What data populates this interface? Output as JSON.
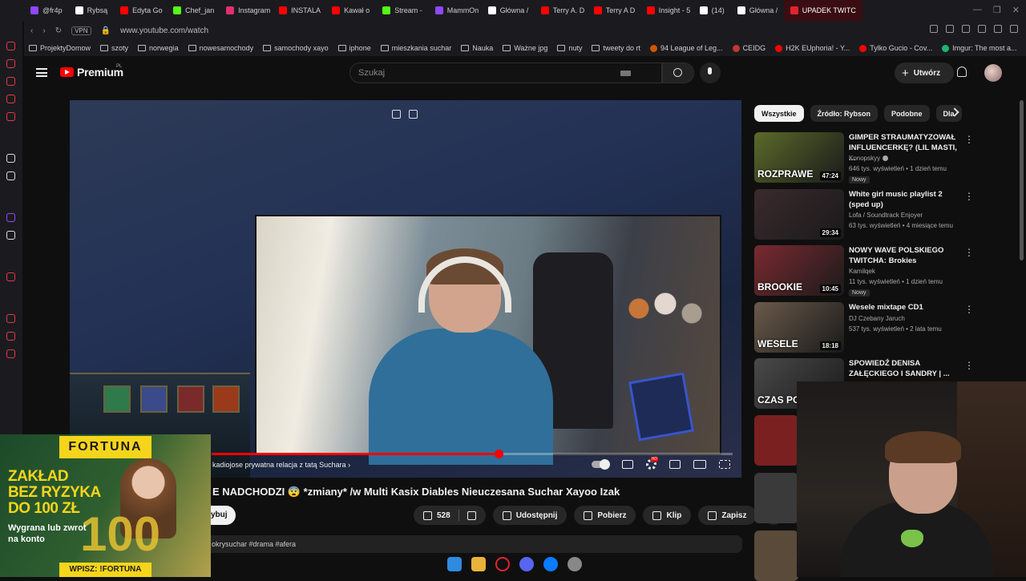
{
  "browser": {
    "tabs": [
      {
        "label": "@fr4p",
        "color": "#9146ff"
      },
      {
        "label": "Rybsą",
        "color": "#ffffff"
      },
      {
        "label": "Edyta Go",
        "color": "#ff0000"
      },
      {
        "label": "Chef_jan",
        "color": "#53fc18"
      },
      {
        "label": "Instagram",
        "color": "#e1306c"
      },
      {
        "label": "INSTALA",
        "color": "#ff0000"
      },
      {
        "label": "Kawał o",
        "color": "#ff0000"
      },
      {
        "label": "Stream -",
        "color": "#53fc18"
      },
      {
        "label": "MammOn",
        "color": "#9146ff"
      },
      {
        "label": "Główna /",
        "color": "#ffffff"
      },
      {
        "label": "Terry A. D",
        "color": "#ff0000"
      },
      {
        "label": "Terry A D",
        "color": "#ff0000"
      },
      {
        "label": "Insight - 5",
        "color": "#ff0000"
      },
      {
        "label": "(14)",
        "color": "#ffffff"
      },
      {
        "label": "Główna /",
        "color": "#ffffff"
      },
      {
        "label": "UPADEK TWITC",
        "color": "#e0242f"
      }
    ],
    "url": "www.youtube.com/watch",
    "vpn_label": "VPN",
    "bookmarks": [
      {
        "label": "ProjektyDomow",
        "kind": "folder"
      },
      {
        "label": "szoty",
        "kind": "folder"
      },
      {
        "label": "norwegia",
        "kind": "folder"
      },
      {
        "label": "nowesamochody",
        "kind": "folder"
      },
      {
        "label": "samochody xayo",
        "kind": "folder"
      },
      {
        "label": "iphone",
        "kind": "folder"
      },
      {
        "label": "mieszkania suchar",
        "kind": "folder"
      },
      {
        "label": "Nauka",
        "kind": "folder"
      },
      {
        "label": "Ważne jpg",
        "kind": "folder"
      },
      {
        "label": "nuty",
        "kind": "folder"
      },
      {
        "label": "tweety do rt",
        "kind": "folder"
      },
      {
        "label": "94 League of Leg...",
        "kind": "site",
        "color": "#d35400"
      },
      {
        "label": "CEIDG",
        "kind": "site",
        "color": "#c0392b"
      },
      {
        "label": "H2K EUphoria! - Y...",
        "kind": "site",
        "color": "#ff0000"
      },
      {
        "label": "Tylko Gucio - Cov...",
        "kind": "site",
        "color": "#ff0000"
      },
      {
        "label": "Imgur: The most a...",
        "kind": "site",
        "color": "#1bb76e"
      }
    ]
  },
  "youtube": {
    "logo_text": "Premium",
    "logo_region": "PL",
    "search_placeholder": "Szukaj",
    "create_label": "Utwórz",
    "player": {
      "chapter_text": "kadiojose prywatna relacja z tatą Suchara  ›",
      "progress": 0.55
    },
    "video_title": "E NADCHODZI 😨 *zmiany* /w Multi Kasix Diables Nieuczesana Suchar Xayoo Izak",
    "subscribe_label": "ybuj",
    "actions": {
      "likes": "528",
      "share": "Udostępnij",
      "download": "Pobierz",
      "clip": "Klip",
      "save": "Zapisz"
    },
    "description_preview": "okrysuchar #drama #afera",
    "chips": [
      "Wszystkie",
      "Źródło: Rybson",
      "Podobne",
      "Dla"
    ],
    "recommendations": [
      {
        "title": "GIMPER STRAUMATYZOWAŁ INFLUENCERKĘ? (LIL MASTI, ...",
        "channel": "Konopskyy",
        "verified": true,
        "meta": "646 tys. wyświetleń • 1 dzień temu",
        "badge": "Nowy",
        "duration": "47:24",
        "thumb_text": "ROZPRAWE",
        "thumb_color": "#5b6a2a"
      },
      {
        "title": "White girl music playlist 2 (sped up)",
        "channel": "Lofa / Soundtrack Enjoyer",
        "verified": false,
        "meta": "63 tys. wyświetleń • 4 miesiące temu",
        "badge": "",
        "duration": "29:34",
        "thumb_text": "",
        "thumb_color": "#3a2a2e"
      },
      {
        "title": "NOWY WAVE POLSKIEGO TWITCHA: Brokies",
        "channel": "Kamilqek",
        "verified": false,
        "meta": "11 tys. wyświetleń • 1 dzień temu",
        "badge": "Nowy",
        "duration": "10:45",
        "thumb_text": "BROOKIE",
        "thumb_color": "#7a2a30"
      },
      {
        "title": "Wesele mixtape CD1",
        "channel": "DJ Czebany Jaruch",
        "verified": false,
        "meta": "537 tys. wyświetleń • 2 lata temu",
        "badge": "",
        "duration": "18:18",
        "thumb_text": "WESELE",
        "thumb_color": "#6a5a4a"
      },
      {
        "title": "SPOWIEDŹ DENISA ZAŁĘCKIEGO I SANDRY | ...",
        "channel": "",
        "verified": false,
        "meta": "",
        "badge": "",
        "duration": "",
        "thumb_text": "CZAS PO",
        "thumb_color": "#4a4a4a"
      }
    ]
  },
  "ad": {
    "brand": "FORTUNA",
    "line1": "ZAKŁAD",
    "line2": "BEZ RYZYKA",
    "line3": "DO 100 ZŁ",
    "sub1": "Wygrana lub zwrot",
    "sub2": "na konto",
    "big_number": "100",
    "code": "WPISZ: !FORTUNA"
  },
  "colors": {
    "brand_red": "#ff0000",
    "accent_yellow": "#f5d51c",
    "background": "#0f0f0f"
  }
}
